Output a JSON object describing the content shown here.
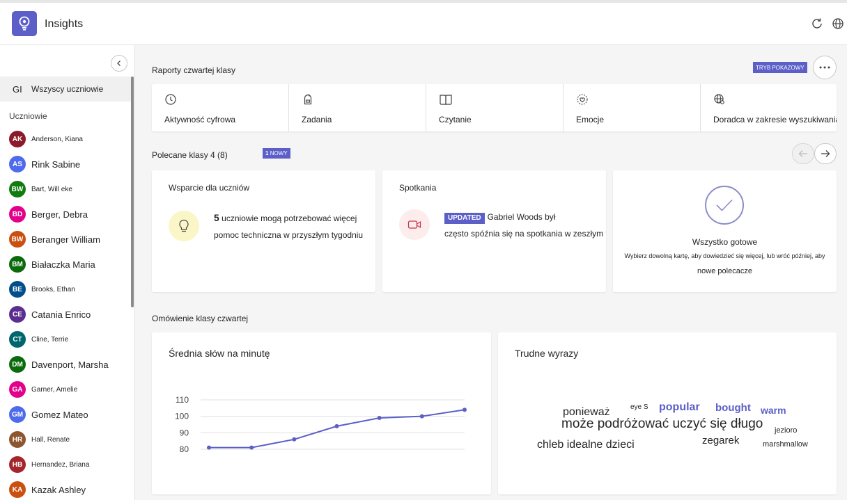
{
  "app": {
    "title": "Insights",
    "accent": "#5b5fc7"
  },
  "header": {
    "refresh_icon": "refresh-icon",
    "globe_icon": "globe-icon"
  },
  "sidebar": {
    "all_students": {
      "initials": "GI",
      "label": "Wszyscy uczniowie"
    },
    "section_label": "Uczniowie",
    "students": [
      {
        "initials": "AK",
        "name": "Anderson, Kiana",
        "color": "#8b1a2b"
      },
      {
        "initials": "AS",
        "name": "Rink Sabine",
        "color": "#4f6bed"
      },
      {
        "initials": "BW",
        "name": "Bart, Will eke",
        "color": "#107c10"
      },
      {
        "initials": "BD",
        "name": "Berger, Debra",
        "color": "#e3008c"
      },
      {
        "initials": "BW",
        "name": "Beranger William",
        "color": "#ca5010"
      },
      {
        "initials": "BM",
        "name": "Białaczka Maria",
        "color": "#0b6a0b"
      },
      {
        "initials": "BE",
        "name": "Brooks, Ethan",
        "color": "#004e8c"
      },
      {
        "initials": "CE",
        "name": "Catania Enrico",
        "color": "#5c2e91"
      },
      {
        "initials": "CT",
        "name": "Cline, Terrie",
        "color": "#00666d"
      },
      {
        "initials": "DM",
        "name": "Davenport, Marsha",
        "color": "#0b6a0b"
      },
      {
        "initials": "GA",
        "name": "Garner, Amelie",
        "color": "#e3008c"
      },
      {
        "initials": "GM",
        "name": "Gomez Mateo",
        "color": "#4f6bed"
      },
      {
        "initials": "HR",
        "name": "Hall, Renate",
        "color": "#8e562e"
      },
      {
        "initials": "HB",
        "name": "Hernandez, Briana",
        "color": "#a4262c"
      },
      {
        "initials": "KA",
        "name": "Kazak Ashley",
        "color": "#ca5010"
      }
    ]
  },
  "reports": {
    "title": "Raporty czwartej klasy",
    "demo_badge": "TRYB POKAZOWY",
    "tiles": [
      {
        "label": "Aktywność cyfrowa",
        "icon": "clock-icon"
      },
      {
        "label": "Zadania",
        "icon": "backpack-icon"
      },
      {
        "label": "Czytanie",
        "icon": "book-icon"
      },
      {
        "label": "Emocje",
        "icon": "heart-icon"
      },
      {
        "label": "Doradca w zakresie wyszukiwania",
        "icon": "globe-search-icon"
      }
    ]
  },
  "recommended": {
    "title": "Polecane klasy 4 (8)",
    "new_count": "1",
    "new_label": "NOWY",
    "cards": {
      "support": {
        "title": "Wsparcie dla uczniów",
        "count": "5",
        "line1": "uczniowie mogą potrzebować więcej",
        "line2": "pomoc techniczna w przyszłym tygodniu"
      },
      "meetings": {
        "title": "Spotkania",
        "badge": "UPDATED",
        "line1": "Gabriel Woods był",
        "line2": "często spóźnia się na spotkania w zeszłym tygodniu"
      },
      "done": {
        "title": "Wszystko gotowe",
        "line1": "Wybierz dowolną kartę, aby dowiedzieć się więcej, lub wróć później, aby",
        "line2": "nowe polecacze"
      }
    }
  },
  "overview": {
    "title": "Omówienie klasy czwartej",
    "wpm_card_title": "Średnia słów na minutę",
    "words_card_title": "Trudne wyrazy",
    "words": [
      {
        "text": "ponieważ",
        "color": "#242424"
      },
      {
        "text": "eye S",
        "color": "#242424"
      },
      {
        "text": "popular",
        "color": "#5b5fc7"
      },
      {
        "text": "bought",
        "color": "#5b5fc7"
      },
      {
        "text": "warm",
        "color": "#5b5fc7"
      },
      {
        "text": "może podróżować uczyć się długo",
        "color": "#242424"
      },
      {
        "text": "jezioro",
        "color": "#242424"
      },
      {
        "text": "chleb idealne dzieci",
        "color": "#242424"
      },
      {
        "text": "zegarek",
        "color": "#242424"
      },
      {
        "text": "marshmallow",
        "color": "#242424"
      }
    ]
  },
  "chart_data": {
    "type": "line",
    "title": "Średnia słów na minutę",
    "ylim": [
      75,
      110
    ],
    "yticks": [
      110,
      100,
      90,
      80
    ],
    "grid": true,
    "series": [
      {
        "values": [
          81,
          81,
          86,
          94,
          99,
          100,
          104
        ],
        "color": "#5b5fc7"
      }
    ]
  }
}
